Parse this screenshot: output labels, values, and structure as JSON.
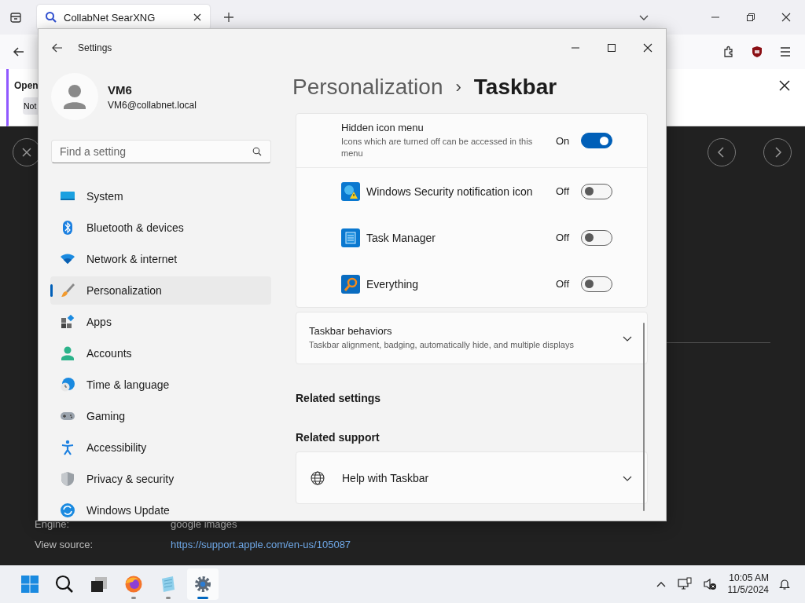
{
  "browser": {
    "tab": {
      "title": "CollabNet SearXNG"
    },
    "notification": {
      "title": "Open",
      "button": "Not"
    },
    "details": [
      {
        "label": "Engine:",
        "value": "google images",
        "kind": "text"
      },
      {
        "label": "View source:",
        "value": "https://support.apple.com/en-us/105087",
        "kind": "link"
      }
    ]
  },
  "settings_window": {
    "title": "Settings",
    "user": {
      "name": "VM6",
      "email": "VM6@collabnet.local"
    },
    "search": {
      "placeholder": "Find a setting"
    },
    "nav": [
      {
        "label": "System",
        "selected": false
      },
      {
        "label": "Bluetooth & devices",
        "selected": false
      },
      {
        "label": "Network & internet",
        "selected": false
      },
      {
        "label": "Personalization",
        "selected": true
      },
      {
        "label": "Apps",
        "selected": false
      },
      {
        "label": "Accounts",
        "selected": false
      },
      {
        "label": "Time & language",
        "selected": false
      },
      {
        "label": "Gaming",
        "selected": false
      },
      {
        "label": "Accessibility",
        "selected": false
      },
      {
        "label": "Privacy & security",
        "selected": false
      },
      {
        "label": "Windows Update",
        "selected": false
      }
    ],
    "breadcrumb": {
      "parent": "Personalization",
      "separator": "›",
      "current": "Taskbar"
    },
    "hidden_icon_menu": {
      "title": "Hidden icon menu",
      "description": "Icons which are turned off can be accessed in this menu",
      "state": "On",
      "on": true
    },
    "icons": [
      {
        "label": "Windows Security notification icon",
        "state": "Off",
        "on": false
      },
      {
        "label": "Task Manager",
        "state": "Off",
        "on": false
      },
      {
        "label": "Everything",
        "state": "Off",
        "on": false
      }
    ],
    "behaviors": {
      "title": "Taskbar behaviors",
      "description": "Taskbar alignment, badging, automatically hide, and multiple displays",
      "expanded": false
    },
    "related_settings": {
      "heading": "Related settings"
    },
    "related_support": {
      "heading": "Related support",
      "items": [
        {
          "label": "Help with Taskbar",
          "expanded": false
        }
      ]
    }
  },
  "taskbar": {
    "apps": [
      {
        "running": false,
        "active": false
      },
      {
        "running": false,
        "active": false
      },
      {
        "running": false,
        "active": false
      },
      {
        "running": true,
        "active": false
      },
      {
        "running": true,
        "active": false
      },
      {
        "running": true,
        "active": true
      }
    ],
    "time": "10:05 AM",
    "date": "11/5/2024"
  }
}
